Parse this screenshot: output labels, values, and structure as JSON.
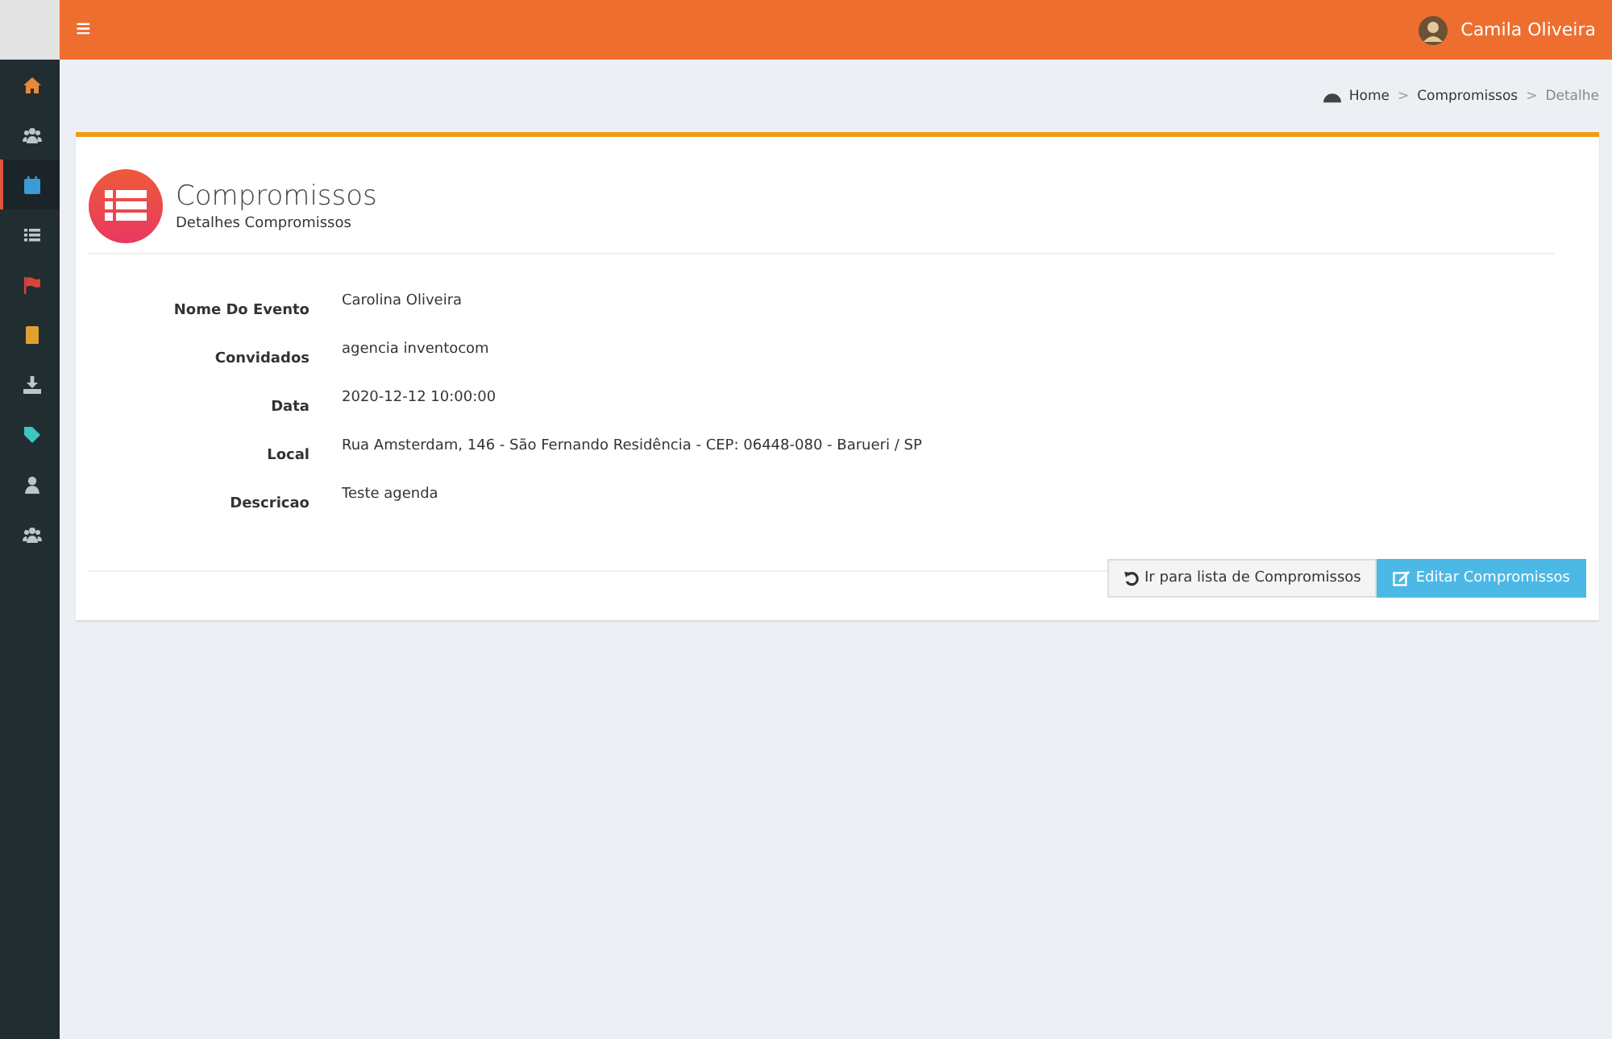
{
  "header": {
    "menu_icon": "≡",
    "user": {
      "name": "Camila Oliveira"
    }
  },
  "sidebar": {
    "items": [
      {
        "kind": "home",
        "color": "#e8893a",
        "selected": false
      },
      {
        "kind": "users",
        "color": "#b8c7ce",
        "selected": false
      },
      {
        "kind": "calendar",
        "color": "#3c9ad8",
        "selected": true
      },
      {
        "kind": "list",
        "color": "#b8c7ce",
        "selected": false
      },
      {
        "kind": "flag",
        "color": "#d9443a",
        "selected": false
      },
      {
        "kind": "book",
        "color": "#e0a030",
        "selected": false
      },
      {
        "kind": "download",
        "color": "#b8c7ce",
        "selected": false
      },
      {
        "kind": "tag",
        "color": "#3ec6c0",
        "selected": false
      },
      {
        "kind": "user",
        "color": "#b8c7ce",
        "selected": false
      },
      {
        "kind": "users",
        "color": "#b8c7ce",
        "selected": false
      }
    ]
  },
  "breadcrumb_separator": ">",
  "breadcrumb": [
    {
      "label": "Home",
      "selected": false
    },
    {
      "label": "Compromissos",
      "selected": false
    },
    {
      "label": "Detalhe",
      "selected": true
    }
  ],
  "card": {
    "title": "Compromissos",
    "subtitle": "Detalhes Compromissos",
    "fields": [
      {
        "label": "Nome Do Evento",
        "value": "Carolina Oliveira"
      },
      {
        "label": "Convidados",
        "value": "agencia inventocom"
      },
      {
        "label": "Data",
        "value": "2020-12-12 10:00:00"
      },
      {
        "label": "Local",
        "value": "Rua Amsterdam, 146 - São Fernando Residência - CEP: 06448-080 - Barueri / SP"
      },
      {
        "label": "Descricao",
        "value": "Teste agenda"
      }
    ],
    "buttons": [
      {
        "label": "Ir para lista de Compromissos",
        "kind": "back"
      },
      {
        "label": "Editar Compromissos",
        "kind": "edit"
      }
    ]
  }
}
